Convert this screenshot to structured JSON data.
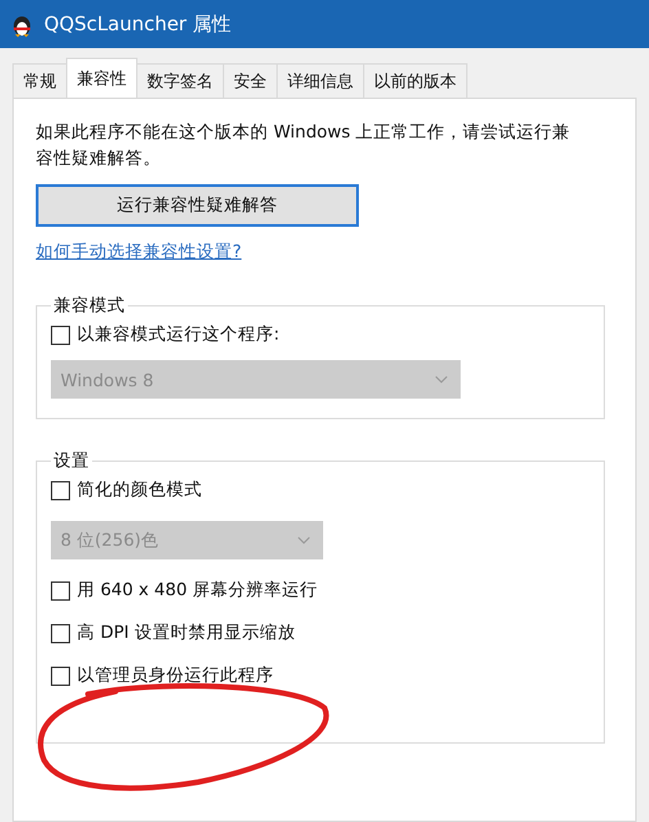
{
  "window": {
    "title": "QQScLauncher 属性"
  },
  "tabs": [
    {
      "label": "常规",
      "selected": false
    },
    {
      "label": "兼容性",
      "selected": true
    },
    {
      "label": "数字签名",
      "selected": false
    },
    {
      "label": "安全",
      "selected": false
    },
    {
      "label": "详细信息",
      "selected": false
    },
    {
      "label": "以前的版本",
      "selected": false
    }
  ],
  "intro": "如果此程序不能在这个版本的 Windows 上正常工作，请尝试运行兼容性疑难解答。",
  "troubleshoot_button": "运行兼容性疑难解答",
  "help_link": "如何手动选择兼容性设置?",
  "compat_mode": {
    "title": "兼容模式",
    "items": [
      {
        "kind": "checkbox",
        "label": "以兼容模式运行这个程序:",
        "checked": false
      },
      {
        "kind": "dropdown",
        "value": "Windows 8",
        "disabled": true
      }
    ]
  },
  "settings": {
    "title": "设置",
    "items": [
      {
        "kind": "checkbox",
        "label": "简化的颜色模式",
        "checked": false
      },
      {
        "kind": "dropdown",
        "value": "8 位(256)色",
        "disabled": true
      },
      {
        "kind": "checkbox",
        "label": "用 640 x 480 屏幕分辨率运行",
        "checked": false
      },
      {
        "kind": "checkbox",
        "label": "高 DPI 设置时禁用显示缩放",
        "checked": false
      },
      {
        "kind": "checkbox",
        "label": "以管理员身份运行此程序",
        "checked": false
      }
    ]
  }
}
